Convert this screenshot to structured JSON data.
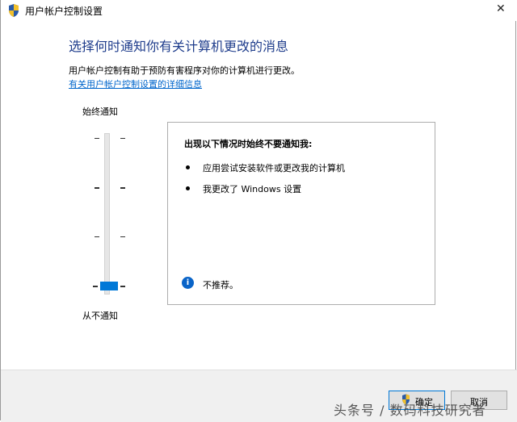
{
  "window": {
    "title": "用户帐户控制设置",
    "close_glyph": "✕"
  },
  "main": {
    "heading": "选择何时通知你有关计算机更改的消息",
    "description": "用户帐户控制有助于预防有害程序对你的计算机进行更改。",
    "help_link": "有关用户帐户控制设置的详细信息"
  },
  "slider": {
    "top_label": "始终通知",
    "bottom_label": "从不通知",
    "levels": 4,
    "selected_level": 1,
    "accent_color": "#0078d7"
  },
  "info_box": {
    "title": "出现以下情况时始终不要通知我:",
    "bullets": [
      "应用尝试安装软件或更改我的计算机",
      "我更改了 Windows 设置"
    ],
    "note_icon": "info-icon",
    "note": "不推荐。"
  },
  "footer": {
    "ok_label": "确定",
    "cancel_label": "取消"
  },
  "watermark": "头条号 / 数码科技研究者"
}
